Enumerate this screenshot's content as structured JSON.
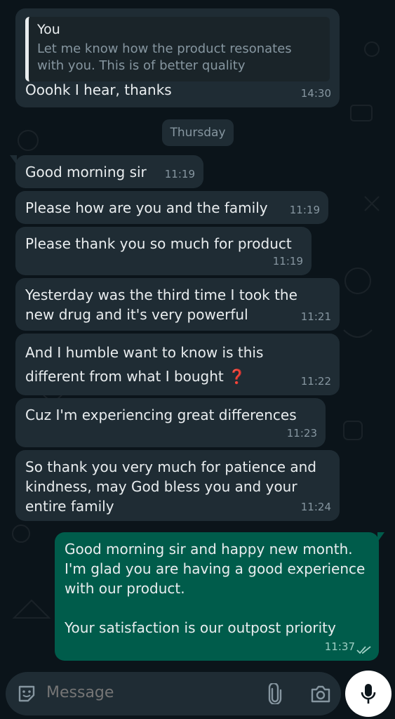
{
  "chat": {
    "reply_message": {
      "quote_author": "You",
      "quote_text": "Let me know how the product resonates with you. This is of better quality",
      "text": "Ooohk I hear, thanks",
      "time": "14:30"
    },
    "day_separator": "Thursday",
    "incoming_messages": [
      {
        "text": "Good morning sir",
        "time": "11:19"
      },
      {
        "text": "Please how are you and the family",
        "time": "11:19"
      },
      {
        "text": "Please thank you so much for product",
        "time": "11:19"
      },
      {
        "text": "Yesterday was the third time I took the new drug and it's very powerful",
        "time": "11:21"
      },
      {
        "text": "And I humble want to know is this different from what I bought",
        "emoji": "❓",
        "time": "11:22"
      },
      {
        "text": "Cuz I'm experiencing great differences",
        "time": "11:23"
      },
      {
        "text": "So thank you very much for patience and kindness, may God bless you and your entire family",
        "time": "11:24"
      }
    ],
    "outgoing_message": {
      "text_line1": "Good morning sir and happy new month. I'm glad you are having a good experience with our product.",
      "text_line2": "Your satisfaction is our outpost priority",
      "time": "11:37",
      "status": "read"
    }
  },
  "composer": {
    "placeholder": "Message",
    "icons": [
      "sticker-icon",
      "attach-icon",
      "camera-icon",
      "mic-icon"
    ]
  },
  "colors": {
    "background": "#0b141a",
    "incoming_bubble": "#1f2c34",
    "outgoing_bubble": "#005c4b",
    "timestamp": "#8696a0"
  }
}
